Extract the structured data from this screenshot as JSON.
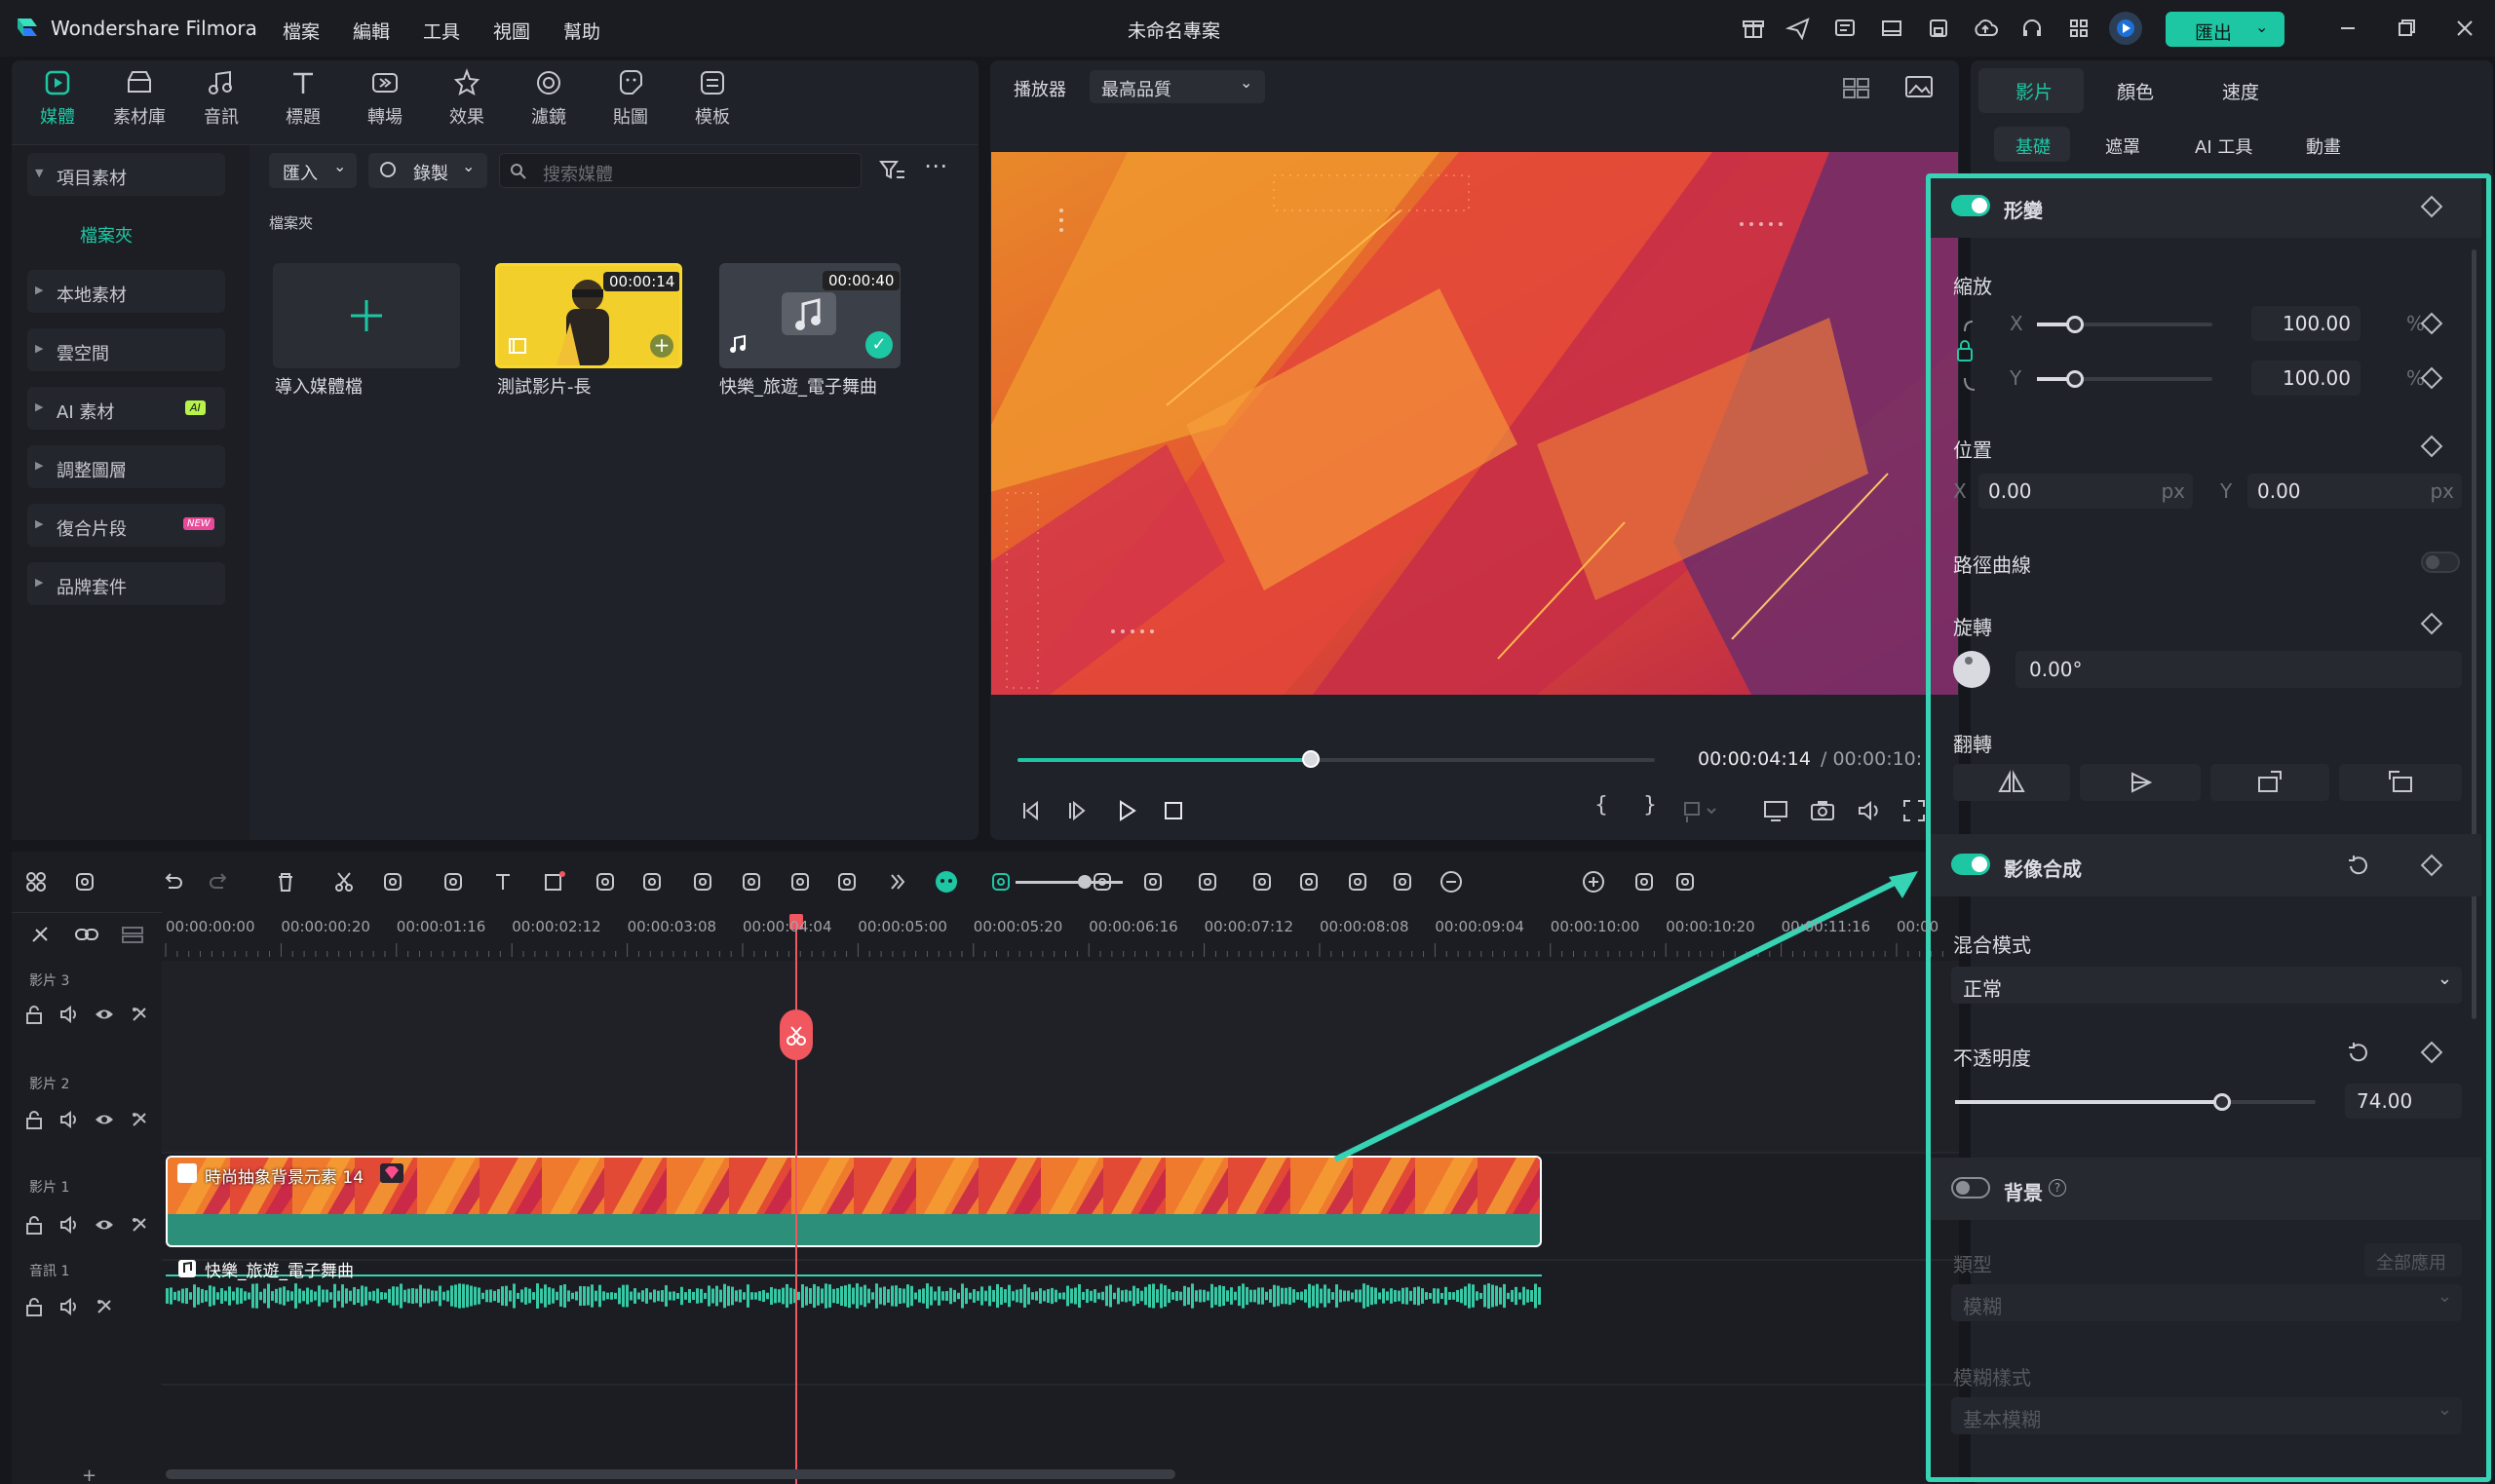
{
  "app": {
    "name": "Wondershare Filmora",
    "project_title": "未命名專案",
    "export_label": "匯出"
  },
  "menu": [
    "檔案",
    "編輯",
    "工具",
    "視圖",
    "幫助"
  ],
  "toolbar": {
    "items": [
      "媒體",
      "素材庫",
      "音訊",
      "標題",
      "轉場",
      "效果",
      "濾鏡",
      "貼圖",
      "模板"
    ],
    "active": 0
  },
  "sidebar": {
    "items": [
      {
        "label": "項目素材",
        "expanded": true
      },
      {
        "label": "檔案夾",
        "sub": true
      },
      {
        "label": "本地素材"
      },
      {
        "label": "雲空間"
      },
      {
        "label": "AI 素材",
        "badge": "AI"
      },
      {
        "label": "調整圖層"
      },
      {
        "label": "復合片段",
        "badge": "NEW"
      },
      {
        "label": "品牌套件"
      }
    ]
  },
  "media": {
    "import_label": "匯入",
    "record_label": "錄製",
    "search_placeholder": "搜索媒體",
    "folder_label": "檔案夾",
    "items": [
      {
        "name": "導入媒體檔"
      },
      {
        "name": "測試影片-長",
        "duration": "00:00:14"
      },
      {
        "name": "快樂_旅遊_電子舞曲",
        "duration": "00:00:40"
      }
    ]
  },
  "player": {
    "label": "播放器",
    "quality": "最高品質",
    "current_time": "00:00:04:14",
    "total_time": "/ 00:00:10:",
    "progress": 0.46
  },
  "inspector": {
    "tabs": [
      "影片",
      "顏色",
      "速度"
    ],
    "subtabs": [
      "基礎",
      "遮罩",
      "AI 工具",
      "動畫"
    ],
    "transform": {
      "title": "形變",
      "scale_label": "縮放",
      "scale_x": "100.00",
      "scale_y": "100.00",
      "percent": "%",
      "position_label": "位置",
      "pos_x": "0.00",
      "pos_y": "0.00",
      "px": "px",
      "path_curve": "路徑曲線",
      "rotate_label": "旋轉",
      "rotate": "0.00°",
      "flip_label": "翻轉",
      "x": "X",
      "y": "Y"
    },
    "compositing": {
      "title": "影像合成",
      "blend_label": "混合模式",
      "blend_value": "正常",
      "opacity_label": "不透明度",
      "opacity": "74.00",
      "opacity_fraction": 0.74
    },
    "background": {
      "title": "背景",
      "type_label": "類型",
      "apply_all": "全部應用",
      "type_value": "模糊",
      "blur_style_label": "模糊樣式",
      "blur_style_value": "基本模糊"
    }
  },
  "timeline": {
    "ruler": [
      "00:00:00:00",
      "00:00:00:20",
      "00:00:01:16",
      "00:00:02:12",
      "00:00:03:08",
      "00:00:04:04",
      "00:00:05:00",
      "00:00:05:20",
      "00:00:06:16",
      "00:00:07:12",
      "00:00:08:08",
      "00:00:09:04",
      "00:00:10:00",
      "00:00:10:20",
      "00:00:11:16",
      "00:00"
    ],
    "tracks": [
      "影片 3",
      "影片 2",
      "影片 1",
      "音訊 1"
    ],
    "video_clip": "時尚抽象背景元素 14",
    "audio_clip": "快樂_旅遊_電子舞曲"
  },
  "colors": {
    "accent": "#1ec7a4",
    "playhead": "#f0575f",
    "highlight": "#36d3b4"
  }
}
